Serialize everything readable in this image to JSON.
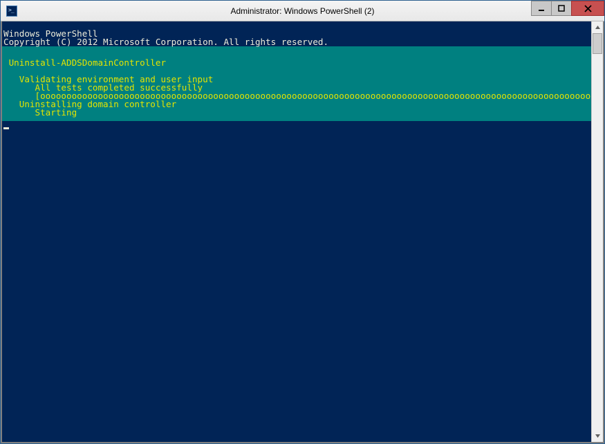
{
  "window": {
    "title": "Administrator: Windows PowerShell (2)"
  },
  "console": {
    "header_line1": "Windows PowerShell",
    "header_line2": "Copyright (C) 2012 Microsoft Corporation. All rights reserved."
  },
  "progress": {
    "command": " Uninstall-ADDSDomainController",
    "validate_label": "   Validating environment and user input",
    "validate_status": "      All tests completed successfully",
    "progress_bar": "      [oooooooooooooooooooooooooooooooooooooooooooooooooooooooooooooooooooooooooooooooooooooooooooooooooooooooooo]",
    "uninstall_label": "   Uninstalling domain controller",
    "uninstall_status": "      Starting"
  }
}
